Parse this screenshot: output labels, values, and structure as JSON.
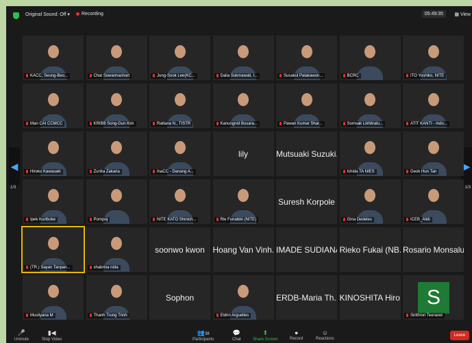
{
  "topbar": {
    "sound_label": "Original Sound: Off",
    "sound_caret": "▾",
    "recording_label": "Recording",
    "time": "05:49:35",
    "view_label": "View"
  },
  "nav": {
    "page_left": "1/3",
    "page_right": "1/3",
    "left_arrow": "◀",
    "right_arrow": "▶"
  },
  "participants": [
    {
      "label": "KACC, Seung-Beo...",
      "name": ""
    },
    {
      "label": "Chat Suwannachart",
      "name": ""
    },
    {
      "label": "Jung-Sook Lee(KC...",
      "name": ""
    },
    {
      "label": "Dalia Sukmawati, I...",
      "name": ""
    },
    {
      "label": "Susakul Palakawon...",
      "name": ""
    },
    {
      "label": "BCRC",
      "name": ""
    },
    {
      "label": "ITO Yoshiko, NITE",
      "name": ""
    },
    {
      "label": "Man CAI CCMCC",
      "name": ""
    },
    {
      "label": "KRIBB Song-Gun Kim",
      "name": ""
    },
    {
      "label": "Rattana N., TISTR",
      "name": ""
    },
    {
      "label": "Kanungnid Busara...",
      "name": ""
    },
    {
      "label": "Pawan Kumar Shar...",
      "name": ""
    },
    {
      "label": "Somsak Likhitratu...",
      "name": ""
    },
    {
      "label": "ATIT KANTI - Indo...",
      "name": ""
    },
    {
      "label": "Hiroko Kawasaki",
      "name": ""
    },
    {
      "label": "Zunita Zakaria",
      "name": ""
    },
    {
      "label": "InaCC - Danang A...",
      "name": ""
    },
    {
      "label": "",
      "name": "lily"
    },
    {
      "label": "",
      "name": "Mutsuaki Suzuki..."
    },
    {
      "label": "Ishida TA NIES",
      "name": ""
    },
    {
      "label": "Geok Hun Tan",
      "name": ""
    },
    {
      "label": "Ipek Kurtboke",
      "name": ""
    },
    {
      "label": "Pornpoj",
      "name": ""
    },
    {
      "label": "NITE KATO Shinich...",
      "name": ""
    },
    {
      "label": "Rie Funabiki (NITE)",
      "name": ""
    },
    {
      "label": "",
      "name": "Suresh Korpole"
    },
    {
      "label": "Gina Dedeles",
      "name": ""
    },
    {
      "label": "ICEB_Alidi",
      "name": ""
    },
    {
      "label": "(TR.) Sayan Tanpan...",
      "name": ""
    },
    {
      "label": "shabrina nida",
      "name": ""
    },
    {
      "label": "",
      "name": "soonwo kwon"
    },
    {
      "label": "",
      "name": "Hoang Van Vinh..."
    },
    {
      "label": "",
      "name": "IMADE SUDIANA"
    },
    {
      "label": "",
      "name": "Rieko Fukai (NB..."
    },
    {
      "label": "",
      "name": "Rosario Monsalud"
    },
    {
      "label": "Musliyana M",
      "name": ""
    },
    {
      "label": "Thanh Trung Trinh",
      "name": ""
    },
    {
      "label": "",
      "name": "Sophon"
    },
    {
      "label": "Eldrin Arguelles",
      "name": ""
    },
    {
      "label": "",
      "name": "ERDB-Maria Th..."
    },
    {
      "label": "",
      "name": "KINOSHITA Hiro..."
    },
    {
      "label": "Sirithron Teeravet",
      "name": "S"
    }
  ],
  "toolbar": {
    "unmute": "Unmute",
    "stop_video": "Stop Video",
    "participants": "Participants",
    "participants_count": "38",
    "chat": "Chat",
    "share_screen": "Share Screen",
    "record": "Record",
    "reactions": "Reactions",
    "end": "Leave"
  }
}
